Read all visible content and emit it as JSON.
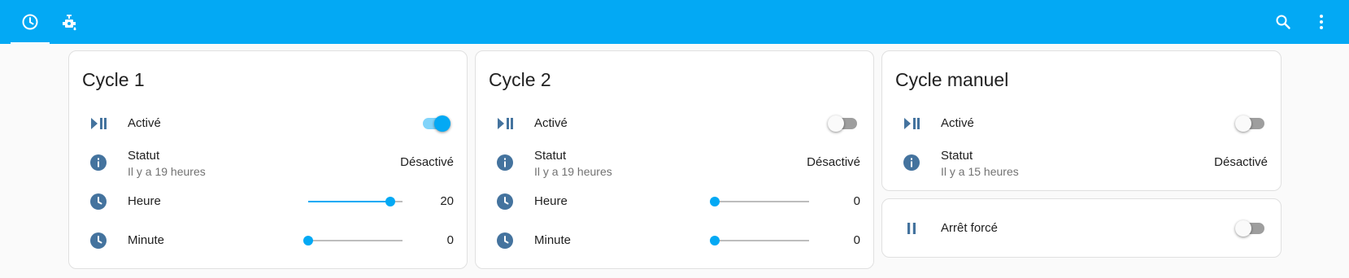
{
  "toolbar": {
    "tabs": [
      {
        "icon": "clock-icon",
        "active": true
      },
      {
        "icon": "water-pump-icon",
        "active": false
      }
    ],
    "actions": [
      {
        "icon": "search-icon"
      },
      {
        "icon": "more-vert-icon"
      }
    ],
    "colors": {
      "primary": "#03a9f4",
      "state_icon": "#44739e"
    }
  },
  "cycle1": {
    "title": "Cycle 1",
    "active_label": "Activé",
    "active_on": true,
    "status_label": "Statut",
    "status_secondary": "Il y a 19 heures",
    "status_value": "Désactivé",
    "hour_label": "Heure",
    "hour_value": "20",
    "hour_fraction": 0.87,
    "minute_label": "Minute",
    "minute_value": "0",
    "minute_fraction": 0
  },
  "cycle2": {
    "title": "Cycle 2",
    "active_label": "Activé",
    "active_on": false,
    "status_label": "Statut",
    "status_secondary": "Il y a 19 heures",
    "status_value": "Désactivé",
    "hour_label": "Heure",
    "hour_value": "0",
    "hour_fraction": 0,
    "minute_label": "Minute",
    "minute_value": "0",
    "minute_fraction": 0
  },
  "manual": {
    "title": "Cycle manuel",
    "active_label": "Activé",
    "active_on": false,
    "status_label": "Statut",
    "status_secondary": "Il y a 15 heures",
    "status_value": "Désactivé"
  },
  "forced": {
    "label": "Arrêt forcé",
    "on": false
  }
}
